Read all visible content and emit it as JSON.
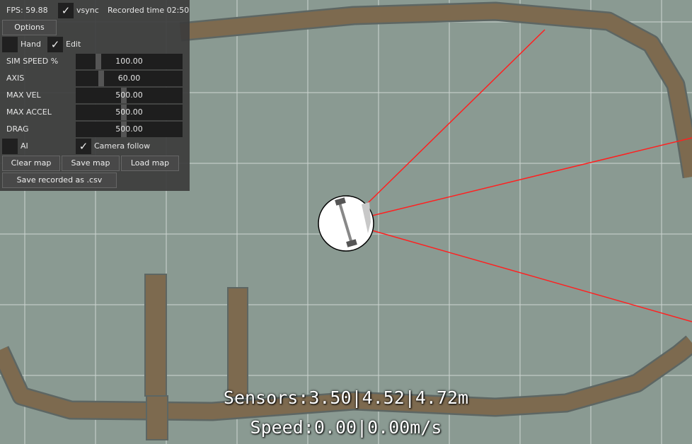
{
  "panel": {
    "fps": "FPS: 59.88",
    "vsync": "vsync",
    "vsync_checked": true,
    "recorded": "Recorded time 02:50",
    "options": "Options",
    "hand": "Hand",
    "hand_checked": false,
    "edit": "Edit",
    "edit_checked": true,
    "sliders": [
      {
        "label": "SIM SPEED %",
        "value": "100.00",
        "level": 0.2
      },
      {
        "label": "AXIS",
        "value": "60.00",
        "level": 0.23
      },
      {
        "label": "MAX VEL",
        "value": "500.00",
        "level": 0.45
      },
      {
        "label": "MAX ACCEL",
        "value": "500.00",
        "level": 0.45
      },
      {
        "label": "DRAG",
        "value": "500.00",
        "level": 0.45
      }
    ],
    "ai": "AI",
    "ai_checked": false,
    "camera_follow": "Camera follow",
    "camera_follow_checked": true,
    "clear_map": "Clear map",
    "save_map": "Save map",
    "load_map": "Load map",
    "save_csv": "Save recorded as .csv"
  },
  "hud": {
    "sensors": "Sensors:3.50|4.52|4.72m",
    "speed": "Speed:0.00|0.00m/s"
  },
  "colors": {
    "track": "#7d6a4f",
    "sensor_ray": "#ff2020",
    "car_body": "#ffffff"
  }
}
